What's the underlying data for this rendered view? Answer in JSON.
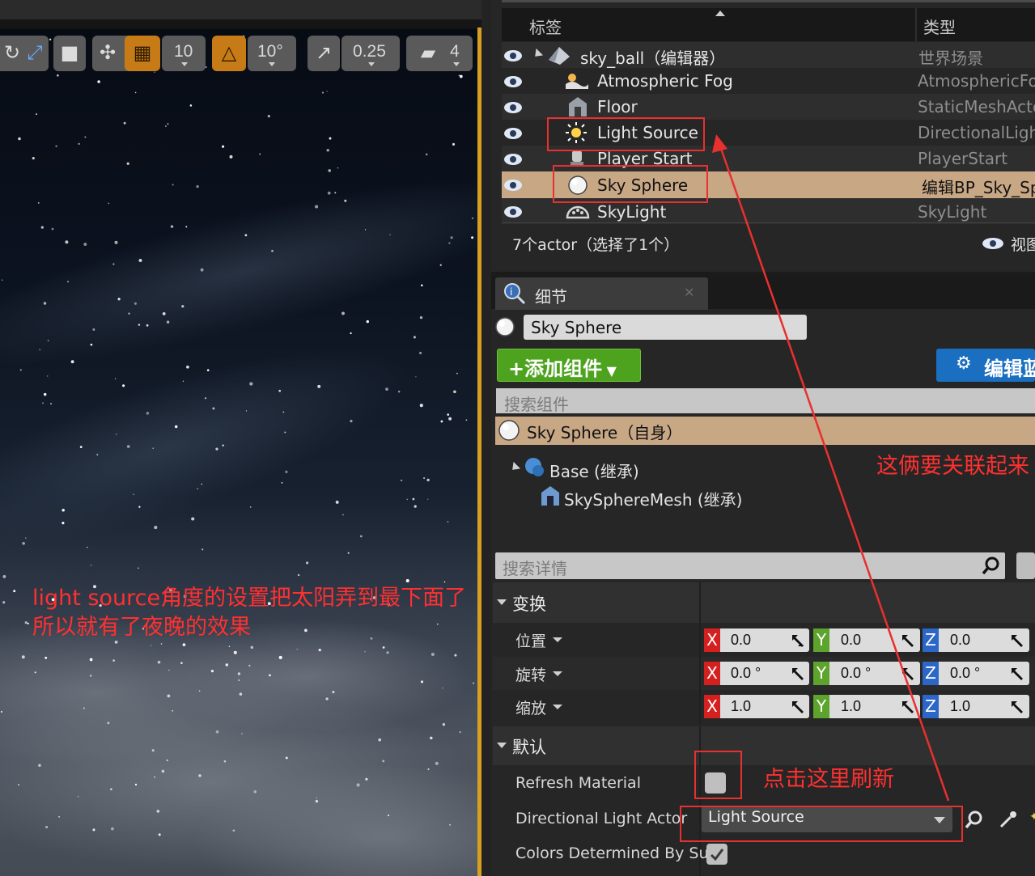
{
  "colors": {
    "accent_orange": "#c77b17",
    "selection": "#c8a785",
    "annotation_red": "#ff3030",
    "add_green": "#4da31e",
    "edit_blue": "#1a6fc0"
  },
  "viewport": {
    "toolbar": {
      "grid_snap": "10",
      "rotation_snap": "10°",
      "scale_snap": "0.25",
      "camera_speed": "4"
    },
    "annotation_line1": "light source角度的设置把太阳弄到最下面了",
    "annotation_line2": "所以就有了夜晚的效果"
  },
  "outliner": {
    "columns": {
      "label": "标签",
      "type": "类型"
    },
    "rows": [
      {
        "label": "sky_ball（编辑器）",
        "type": "世界场景",
        "icon": "world-icon"
      },
      {
        "label": "Atmospheric Fog",
        "type": "AtmosphericFog",
        "icon": "fog-icon"
      },
      {
        "label": "Floor",
        "type": "StaticMeshActor",
        "icon": "mesh-icon"
      },
      {
        "label": "Light Source",
        "type": "DirectionalLight",
        "icon": "sun-icon"
      },
      {
        "label": "Player Start",
        "type": "PlayerStart",
        "icon": "player-start-icon"
      },
      {
        "label": "Sky Sphere",
        "type": "编辑BP_Sky_Sphere",
        "icon": "sphere-icon",
        "selected": true
      },
      {
        "label": "SkyLight",
        "type": "SkyLight",
        "icon": "skylight-icon"
      }
    ],
    "footer": {
      "count": "7个actor（选择了1个）",
      "view_options": "视图选项"
    }
  },
  "details": {
    "tab_label": "细节",
    "actor_name": "Sky Sphere",
    "add_component": "添加组件",
    "edit_blueprint": "编辑蓝图",
    "search_components_placeholder": "搜索组件",
    "components": {
      "self": "Sky Sphere（自身）",
      "base": "Base (继承)",
      "mesh": "SkySphereMesh (继承)"
    },
    "relate_annotation": "这俩要关联起来",
    "search_details_placeholder": "搜索详情",
    "transform": {
      "section": "变换",
      "location": {
        "label": "位置",
        "x": "0.0",
        "y": "0.0",
        "z": "0.0"
      },
      "rotation": {
        "label": "旋转",
        "x": "0.0 °",
        "y": "0.0 °",
        "z": "0.0 °"
      },
      "scale": {
        "label": "缩放",
        "x": "1.0",
        "y": "1.0",
        "z": "1.0"
      },
      "axis": {
        "x": "X",
        "y": "Y",
        "z": "Z"
      }
    },
    "default": {
      "section": "默认",
      "refresh_material": "Refresh Material",
      "refresh_annotation": "点击这里刷新",
      "directional_light_actor": "Directional Light Actor",
      "directional_light_value": "Light Source",
      "colors_by_sun": "Colors Determined By Sun",
      "colors_by_sun_checked": true,
      "refresh_checked": false
    }
  }
}
